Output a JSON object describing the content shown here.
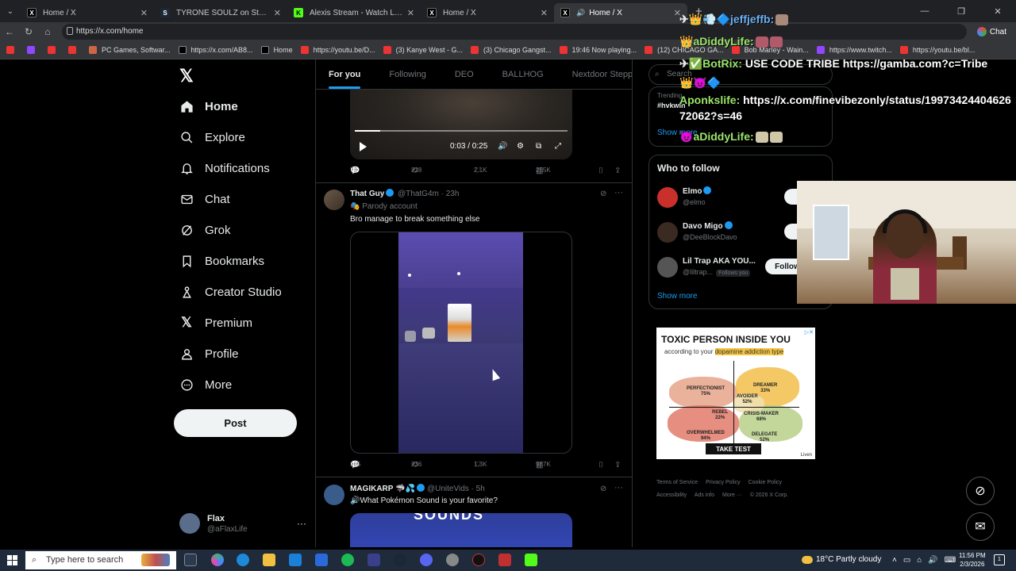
{
  "browser": {
    "tabs": [
      {
        "title": "Home / X",
        "active": false
      },
      {
        "title": "TYRONE SOULZ on Steam",
        "active": false
      },
      {
        "title": "Alexis Stream - Watch Live on Kick",
        "active": false
      },
      {
        "title": "Home / X",
        "active": false
      },
      {
        "title": "Home / X",
        "active": true
      }
    ],
    "url": "https://x.com/home",
    "chat_label": "Chat",
    "bookmarks": [
      "PC Games, Softwar...",
      "https://x.com/AB8...",
      "Home",
      "https://youtu.be/D...",
      "(3) Kanye West - G...",
      "(3) Chicago Gangst...",
      "19:46 Now playing...",
      "(12) CHICAGO GA...",
      "Bob Marley - Wain...",
      "https://www.twitch...",
      "https://youtu.be/bl..."
    ]
  },
  "nav": {
    "items": [
      {
        "label": "Home",
        "icon": "home-icon"
      },
      {
        "label": "Explore",
        "icon": "search-icon"
      },
      {
        "label": "Notifications",
        "icon": "bell-icon"
      },
      {
        "label": "Chat",
        "icon": "mail-icon"
      },
      {
        "label": "Grok",
        "icon": "grok-icon"
      },
      {
        "label": "Bookmarks",
        "icon": "bookmark-icon"
      },
      {
        "label": "Creator Studio",
        "icon": "creator-icon"
      },
      {
        "label": "Premium",
        "icon": "x-icon"
      },
      {
        "label": "Profile",
        "icon": "person-icon"
      },
      {
        "label": "More",
        "icon": "more-icon"
      }
    ],
    "post_label": "Post",
    "account": {
      "name": "Flax",
      "handle": "@aFlaxLife"
    }
  },
  "feed": {
    "tabs": [
      "For you",
      "Following",
      "DEO",
      "BALLHOG",
      "Nextdoor Steppas"
    ],
    "post1": {
      "video_time": "0:03 / 0:25",
      "video_progress": 0.12,
      "replies": "73",
      "reposts": "228",
      "likes": "2.1K",
      "views": "255K"
    },
    "post2": {
      "name": "That Guy",
      "meta": "@ThatG4m · 23h",
      "parody": "Parody account",
      "text": "Bro manage to break something else",
      "replies": "105",
      "reposts": "236",
      "likes": "1.3K",
      "views": "987K"
    },
    "post3": {
      "name": "MAGIKARP",
      "meta": "@UniteVids · 5h",
      "text": "🔊What Pokémon Sound is your favorite?",
      "video_word": "SOUNDS"
    }
  },
  "sidebar": {
    "search_placeholder": "Search",
    "trending_label": "Trending",
    "trending_tag": "#hvkwin",
    "show_more": "Show more",
    "who_to_follow": "Who to follow",
    "suggestions": [
      {
        "name": "Elmo",
        "handle": "@elmo",
        "verified": true,
        "follows_you": false,
        "button": "F"
      },
      {
        "name": "Davo Migo",
        "handle": "@DeeBlockDavo",
        "verified": true,
        "follows_you": false,
        "button": "F"
      },
      {
        "name": "Lil Trap AKA YOU...",
        "handle": "@liltrap...",
        "verified": false,
        "follows_you": true,
        "button": "Follow"
      }
    ],
    "follows_you_label": "Follows you",
    "show_more_2": "Show more",
    "ad": {
      "title": "TOXIC PERSON INSIDE YOU",
      "subtitle_pre": "according to your ",
      "subtitle_hl": "dopamine addiction type",
      "zones": [
        {
          "name": "PERFECTIONIST",
          "pct": "75%"
        },
        {
          "name": "DREAMER",
          "pct": "33%"
        },
        {
          "name": "AVOIDER",
          "pct": "52%"
        },
        {
          "name": "REBEL",
          "pct": "22%"
        },
        {
          "name": "CRISIS-MAKER",
          "pct": "68%"
        },
        {
          "name": "OVERWHELMED",
          "pct": "94%"
        },
        {
          "name": "DELEGATE",
          "pct": "52%"
        }
      ],
      "cta": "TAKE TEST",
      "brand": "Liven"
    },
    "footer": [
      "Terms of Service",
      "Privacy Policy",
      "Cookie Policy",
      "Accessibility",
      "Ads info",
      "More ···",
      "© 2026 X Corp."
    ]
  },
  "stream_chat": [
    {
      "user": "jeffjeffb:",
      "msg": "",
      "color": "blue"
    },
    {
      "user": "aDiddyLife:",
      "msg": "",
      "color": "green"
    },
    {
      "user": "BotRix:",
      "msg": "USE CODE TRIBE https://gamba.com?c=Tribe",
      "color": "green"
    },
    {
      "user": "Aponkslife:",
      "msg": "https://x.com/finevibezonly/status/19973424404626",
      "msg2": "72062?s=46",
      "color": "green"
    },
    {
      "user": "aDiddyLife:",
      "msg": "",
      "color": "green"
    }
  ],
  "taskbar": {
    "search_placeholder": "Type here to search",
    "weather": "18°C  Partly cloudy",
    "time": "11:56 PM",
    "date": "2/3/2026",
    "notif_count": "1"
  }
}
